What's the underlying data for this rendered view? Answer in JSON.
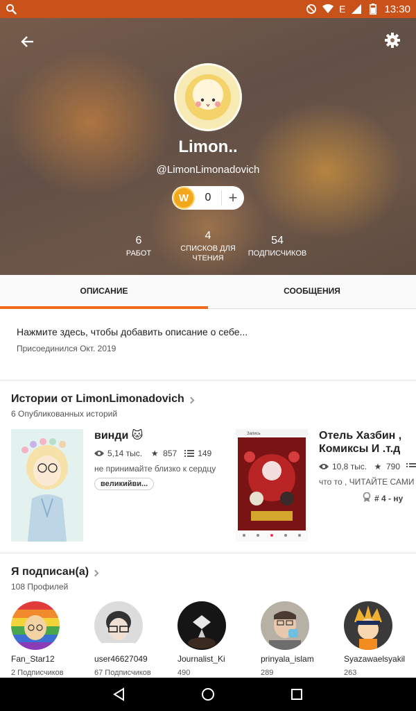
{
  "status_bar": {
    "time": "13:30",
    "net": "E"
  },
  "profile": {
    "display_name": "Limon..",
    "handle": "@LimonLimonadovich",
    "coins": "0",
    "coin_letter": "W",
    "stats": [
      {
        "value": "6",
        "label": "РАБОТ"
      },
      {
        "value": "4",
        "label": "СПИСКОВ ДЛЯ ЧТЕНИЯ"
      },
      {
        "value": "54",
        "label": "ПОДПИСЧИКОВ"
      }
    ]
  },
  "tabs": [
    {
      "label": "ОПИСАНИЕ",
      "active": true
    },
    {
      "label": "СООБЩЕНИЯ",
      "active": false
    }
  ],
  "description": {
    "prompt": "Нажмите здесь, чтобы добавить описание о себе...",
    "joined": "Присоединился Окт. 2019"
  },
  "stories_section": {
    "title": "Истории от LimonLimonadovich",
    "subtitle": "6 Опубликованных историй",
    "items": [
      {
        "title": "винди 🐱",
        "reads": "5,14 тыс.",
        "votes": "857",
        "parts": "149",
        "desc": "не принимайте близко к сердцу",
        "tag": "великийви..."
      },
      {
        "title_line1": "Отель Хазбин ,",
        "title_line2": "Комиксы И .т.д",
        "reads": "10,8 тыс.",
        "votes": "790",
        "desc": "что то , ЧИТАЙТЕ САМИ",
        "rank": "# 4 - ну",
        "cover_caption": "Запись"
      }
    ]
  },
  "following_section": {
    "title": "Я подписан(а)",
    "subtitle": "108 Профилей",
    "items": [
      {
        "name": "Fan_Star12",
        "followers": "2 Подписчиков"
      },
      {
        "name": "user46627049",
        "followers": "67 Подписчиков"
      },
      {
        "name": "Journalist_Ki",
        "followers": "490"
      },
      {
        "name": "prinyala_islam",
        "followers": "289"
      },
      {
        "name": "Syazawaelsyakil",
        "followers": "263"
      }
    ]
  },
  "colors": {
    "accent": "#f26a1b",
    "status_bar": "#c9521b",
    "coin": "#f2a81d"
  }
}
